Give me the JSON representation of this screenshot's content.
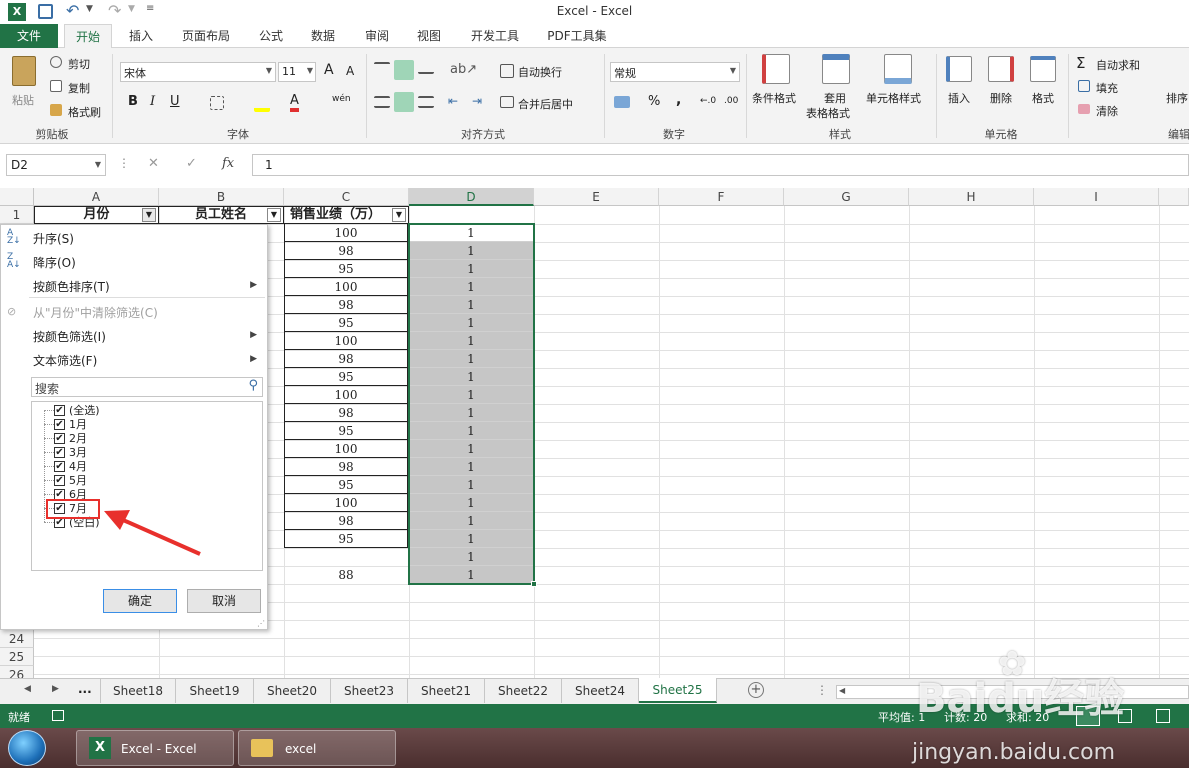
{
  "app": {
    "title": "Excel - Excel",
    "accent": "#217346"
  },
  "tabs": [
    "文件",
    "开始",
    "插入",
    "页面布局",
    "公式",
    "数据",
    "审阅",
    "视图",
    "开发工具",
    "PDF工具集"
  ],
  "ribbon": {
    "clipboard": {
      "paste": "粘贴",
      "cut": "剪切",
      "copy": "复制",
      "format_painter": "格式刷",
      "group": "剪贴板"
    },
    "font": {
      "name": "宋体",
      "size": "11",
      "grow": "A",
      "shrink": "A",
      "bold": "B",
      "italic": "I",
      "underline": "U",
      "font_color": "A",
      "phonetic": "wén",
      "group": "字体"
    },
    "align": {
      "wrap": "自动换行",
      "merge": "合并后居中",
      "group": "对齐方式"
    },
    "number": {
      "format": "常规",
      "percent": "%",
      "comma": ",",
      "inc_decimal": "←.0",
      "dec_decimal": ".00",
      "group": "数字"
    },
    "styles": {
      "conditional": "条件格式",
      "table_line1": "套用",
      "table_line2": "表格格式",
      "cell_styles": "单元格样式",
      "group": "样式"
    },
    "cells": {
      "insert": "插入",
      "delete": "删除",
      "format": "格式",
      "group": "单元格"
    },
    "editing": {
      "autosum": "自动求和",
      "fill": "填充",
      "clear": "清除",
      "sort": "排序",
      "group": "编辑"
    }
  },
  "formula_bar": {
    "name_box": "D2",
    "cancel": "✕",
    "enter": "✓",
    "fx": "fx",
    "value": "1"
  },
  "columns": [
    "A",
    "B",
    "C",
    "D",
    "E",
    "F",
    "G",
    "H",
    "I"
  ],
  "headers": {
    "a": "月份",
    "b": "员工姓名",
    "c": "销售业绩（万）"
  },
  "rows_shown": [
    "1",
    "24",
    "25",
    "26"
  ],
  "col_c": [
    "100",
    "98",
    "95",
    "100",
    "98",
    "95",
    "100",
    "98",
    "95",
    "100",
    "98",
    "95",
    "100",
    "98",
    "95",
    "100",
    "98",
    "95",
    "",
    "88"
  ],
  "col_d": [
    "1",
    "1",
    "1",
    "1",
    "1",
    "1",
    "1",
    "1",
    "1",
    "1",
    "1",
    "1",
    "1",
    "1",
    "1",
    "1",
    "1",
    "1",
    "1",
    "1"
  ],
  "filter_menu": {
    "sort_asc": "升序(S)",
    "sort_desc": "降序(O)",
    "sort_color": "按颜色排序(T)",
    "clear_filter": "从\"月份\"中清除筛选(C)",
    "filter_color": "按颜色筛选(I)",
    "text_filter": "文本筛选(F)",
    "search_placeholder": "搜索",
    "items": [
      "(全选)",
      "1月",
      "2月",
      "3月",
      "4月",
      "5月",
      "6月",
      "7月",
      "(空白)"
    ],
    "ok": "确定",
    "cancel": "取消"
  },
  "sheets": [
    "Sheet18",
    "Sheet19",
    "Sheet20",
    "Sheet23",
    "Sheet21",
    "Sheet22",
    "Sheet24",
    "Sheet25"
  ],
  "active_sheet": "Sheet25",
  "sheet_more": "...",
  "status": {
    "ready": "就绪",
    "average": "平均值: 1",
    "count": "计数: 20",
    "sum": "求和: 20"
  },
  "taskbar": {
    "excel": "Excel - Excel",
    "folder": "excel"
  },
  "watermark": {
    "brand": "Baidu经验",
    "url": "jingyan.baidu.com"
  }
}
